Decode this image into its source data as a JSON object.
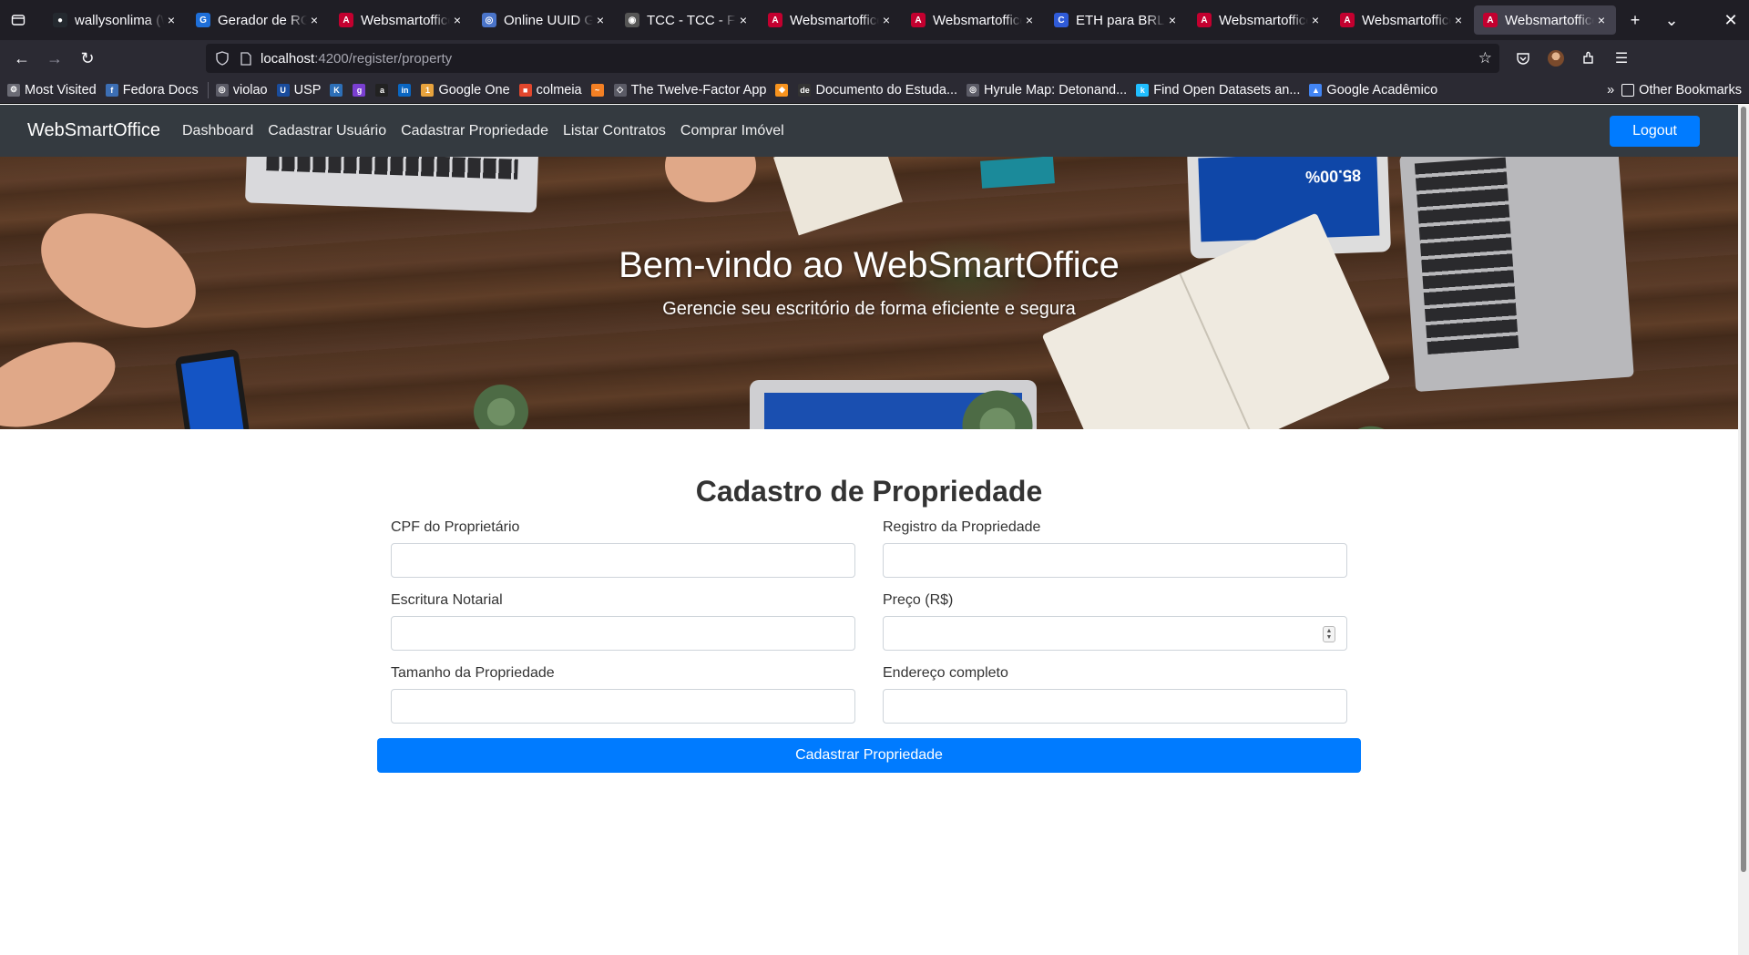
{
  "browser": {
    "tabs": [
      {
        "title": "wallysonlima (W",
        "favicon_color": "#24292f",
        "favicon_char": "●"
      },
      {
        "title": "Gerador de RG",
        "favicon_color": "#1e6fd9",
        "favicon_char": "G"
      },
      {
        "title": "Websmartoffice",
        "favicon_color": "#c3002f",
        "favicon_char": "A"
      },
      {
        "title": "Online UUID Ge",
        "favicon_color": "#4a74c9",
        "favicon_char": "◎"
      },
      {
        "title": "TCC - TCC - Fro",
        "favicon_color": "#555555",
        "favicon_char": "◉"
      },
      {
        "title": "Websmartoffice",
        "favicon_color": "#c3002f",
        "favicon_char": "A"
      },
      {
        "title": "Websmartoffice",
        "favicon_color": "#c3002f",
        "favicon_char": "A"
      },
      {
        "title": "ETH para BRL: C",
        "favicon_color": "#2f5bd8",
        "favicon_char": "C"
      },
      {
        "title": "Websmartoffice",
        "favicon_color": "#c3002f",
        "favicon_char": "A"
      },
      {
        "title": "Websmartoffice",
        "favicon_color": "#c3002f",
        "favicon_char": "A"
      },
      {
        "title": "Websmartoffice",
        "favicon_color": "#c3002f",
        "favicon_char": "A",
        "active": true
      }
    ],
    "url_host": "localhost",
    "url_path": ":4200/register/property",
    "bookmarks": [
      {
        "label": "Most Visited",
        "color": "#6b6b75",
        "char": "⚙"
      },
      {
        "label": "Fedora Docs",
        "color": "#3c6eb4",
        "char": "f"
      },
      {
        "label": "violao",
        "color": "#5b5b66",
        "char": "◎"
      },
      {
        "label": "USP",
        "color": "#1a4c9c",
        "char": "U"
      },
      {
        "label": "",
        "color": "#2d6fb7",
        "char": "K"
      },
      {
        "label": "",
        "color": "#7a3fd1",
        "char": "g"
      },
      {
        "label": "",
        "color": "#222222",
        "char": "a"
      },
      {
        "label": "",
        "color": "#0a66c2",
        "char": "in"
      },
      {
        "label": "Google One",
        "color": "#e8a33d",
        "char": "1"
      },
      {
        "label": "colmeia",
        "color": "#e2472d",
        "char": "■"
      },
      {
        "label": "",
        "color": "#f48024",
        "char": "~"
      },
      {
        "label": "The Twelve-Factor App",
        "color": "#5b5b66",
        "char": "◇"
      },
      {
        "label": "",
        "color": "#f7931e",
        "char": "◆"
      },
      {
        "label": "Documento do Estuda...",
        "color": "#333333",
        "char": "de"
      },
      {
        "label": "Hyrule Map: Detonand...",
        "color": "#5b5b66",
        "char": "◎"
      },
      {
        "label": "Find Open Datasets an...",
        "color": "#20beff",
        "char": "k"
      },
      {
        "label": "Google Acadêmico",
        "color": "#4285f4",
        "char": "▲"
      }
    ],
    "other_bookmarks": "Other Bookmarks"
  },
  "app": {
    "brand": "WebSmartOffice",
    "nav": [
      "Dashboard",
      "Cadastrar Usuário",
      "Cadastrar Propriedade",
      "Listar Contratos",
      "Comprar Imóvel"
    ],
    "logout": "Logout",
    "hero_title": "Bem-vindo ao WebSmartOffice",
    "hero_subtitle": "Gerencie seu escritório de forma eficiente e segura",
    "form": {
      "title": "Cadastro de Propriedade",
      "fields": {
        "cpf": {
          "label": "CPF do Proprietário",
          "value": ""
        },
        "registro": {
          "label": "Registro da Propriedade",
          "value": ""
        },
        "escritura": {
          "label": "Escritura Notarial",
          "value": ""
        },
        "preco": {
          "label": "Preço (R$)",
          "value": ""
        },
        "tamanho": {
          "label": "Tamanho da Propriedade",
          "value": ""
        },
        "endereco": {
          "label": "Endereço completo",
          "value": ""
        }
      },
      "submit": "Cadastrar Propriedade"
    }
  },
  "colors": {
    "primary": "#007bff",
    "navbar": "#343a40"
  }
}
